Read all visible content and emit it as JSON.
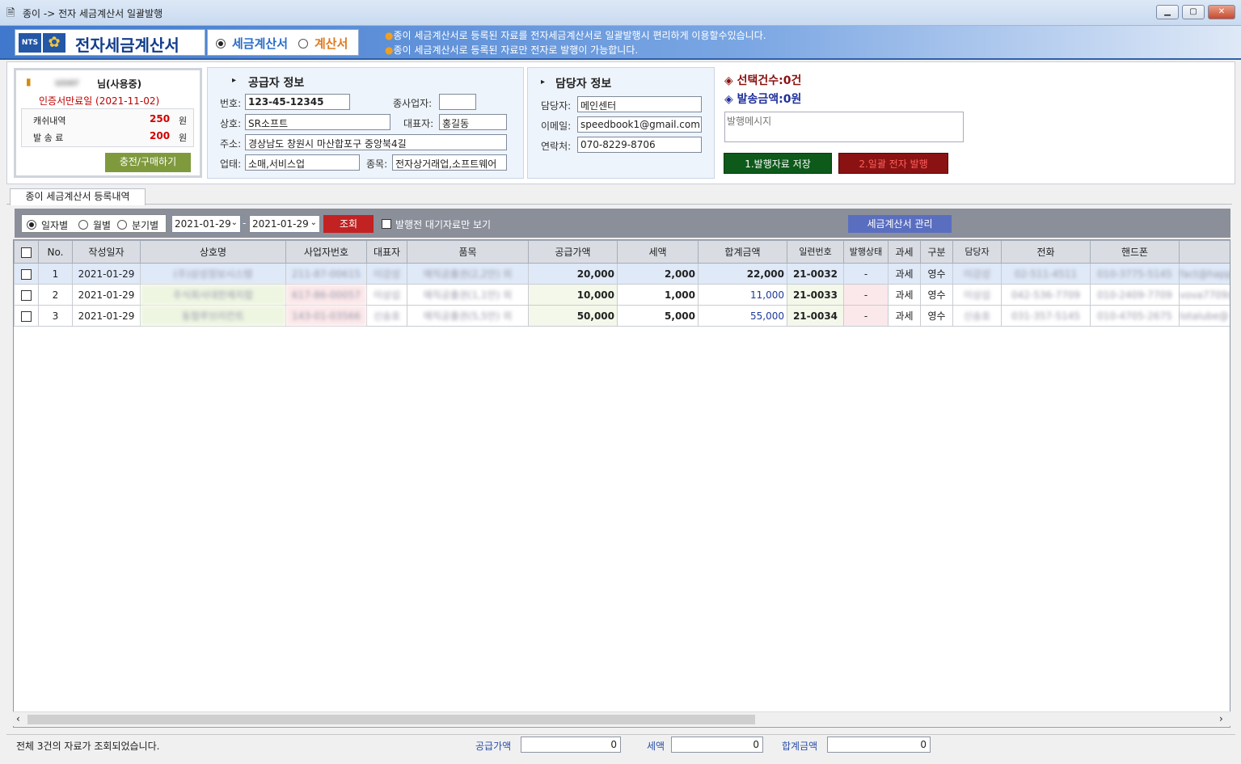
{
  "window": {
    "title": "종이 -> 전자 세금계산서 일괄발행"
  },
  "brand": {
    "nts": "NTS",
    "title": "전자세금계산서"
  },
  "mode": {
    "tax_invoice": "세금계산서",
    "invoice": "계산서"
  },
  "notices": [
    "종이 세금계산서로 등록된 자료를 전자세금계산서로 일괄발행시 편리하게 이용할수있습니다.",
    "종이 세금계산서로 등록된 자료만 전자로 발행이 가능합니다."
  ],
  "account": {
    "user_name": "user",
    "user_suffix": "님(사용중)",
    "cert_expiry": "인증서만료일 (2021-11-02)",
    "cash_label": "캐쉬내역",
    "cash_value": "250",
    "cash_unit": "원",
    "fee_label": "발 송 료",
    "fee_value": "200",
    "fee_unit": "원",
    "charge_button": "충전/구매하기"
  },
  "supplier": {
    "section_title": "공급자 정보",
    "reg_label": "번호:",
    "reg_value": "123-45-12345",
    "branch_label": "종사업자:",
    "branch_value": "",
    "name_label": "상호:",
    "name_value": "SR소프트",
    "ceo_label": "대표자:",
    "ceo_value": "홍길동",
    "addr_label": "주소:",
    "addr_value": "경상남도 창원시 마산합포구 중앙북4길",
    "biz_type_label": "업태:",
    "biz_type_value": "소매,서비스업",
    "biz_item_label": "종목:",
    "biz_item_value": "전자상거래업,소프트웨어"
  },
  "manager": {
    "section_title": "담당자 정보",
    "manager_label": "담당자:",
    "manager_value": "메인센터",
    "email_label": "이메일:",
    "email_value": "speedbook1@gmail.com",
    "phone_label": "연락처:",
    "phone_value": "070-8229-8706"
  },
  "summary": {
    "selected_count": "선택건수:0건",
    "send_amount": "발송금액:0원",
    "message_placeholder": "발행메시지",
    "save_button": "1.발행자료 저장",
    "issue_button": "2.일괄 전자 발행"
  },
  "tab": {
    "label": "종이 세금계산서 등록내역"
  },
  "filter": {
    "daily": "일자별",
    "monthly": "월별",
    "quarterly": "분기별",
    "date_from": "2021-01-29",
    "date_sep": "-",
    "date_to": "2021-01-29",
    "search_button": "조회",
    "pending_only": "발행전 대기자료만 보기",
    "manage_button": "세금계산서 관리"
  },
  "grid": {
    "columns": [
      "No.",
      "작성일자",
      "상호명",
      "사업자번호",
      "대표자",
      "품목",
      "공급가액",
      "세액",
      "합계금액",
      "일련번호",
      "발행상태",
      "과세",
      "구분",
      "담당자",
      "전화",
      "핸드폰",
      "이"
    ],
    "rows": [
      {
        "no": "1",
        "date": "2021-01-29",
        "company": "(주)삼성정보시스템",
        "biz_no": "211-87-00615",
        "ceo": "이강성",
        "item": "매직공출권(2,2만) 외",
        "supply": "20,000",
        "tax": "2,000",
        "total": "22,000",
        "serial": "21-0032",
        "status": "-",
        "taxation": "과세",
        "kind": "영수",
        "manager": "이강성",
        "phone": "02-511-4511",
        "mobile": "010-3775-5145",
        "email": "fact@happy"
      },
      {
        "no": "2",
        "date": "2021-01-29",
        "company": "주식회사대한제지합",
        "biz_no": "617-86-00057",
        "ceo": "이상섭",
        "item": "매직공출권(1,1만) 외",
        "supply": "10,000",
        "tax": "1,000",
        "total": "11,000",
        "serial": "21-0033",
        "status": "-",
        "taxation": "과세",
        "kind": "영수",
        "manager": "이상섭",
        "phone": "042-536-7709",
        "mobile": "010-2409-7709",
        "email": "vova7709@"
      },
      {
        "no": "3",
        "date": "2021-01-29",
        "company": "동협루브리칸트",
        "biz_no": "143-01-03566",
        "ceo": "신송호",
        "item": "매직공출권(5,5만) 외",
        "supply": "50,000",
        "tax": "5,000",
        "total": "55,000",
        "serial": "21-0034",
        "status": "-",
        "taxation": "과세",
        "kind": "영수",
        "manager": "신송호",
        "phone": "031-357-5145",
        "mobile": "010-4705-2675",
        "email": "lotalube@"
      }
    ]
  },
  "status_bar": {
    "message": "전체 3건의 자료가 조회되었습니다.",
    "supply_label": "공급가액",
    "supply_value": "0",
    "tax_label": "세액",
    "tax_value": "0",
    "total_label": "합계금액",
    "total_value": "0"
  },
  "colors": {
    "accent_blue": "#2457a6",
    "cash_red": "#d00000",
    "save_green": "#0d5a1a",
    "issue_red": "#8a1212"
  }
}
